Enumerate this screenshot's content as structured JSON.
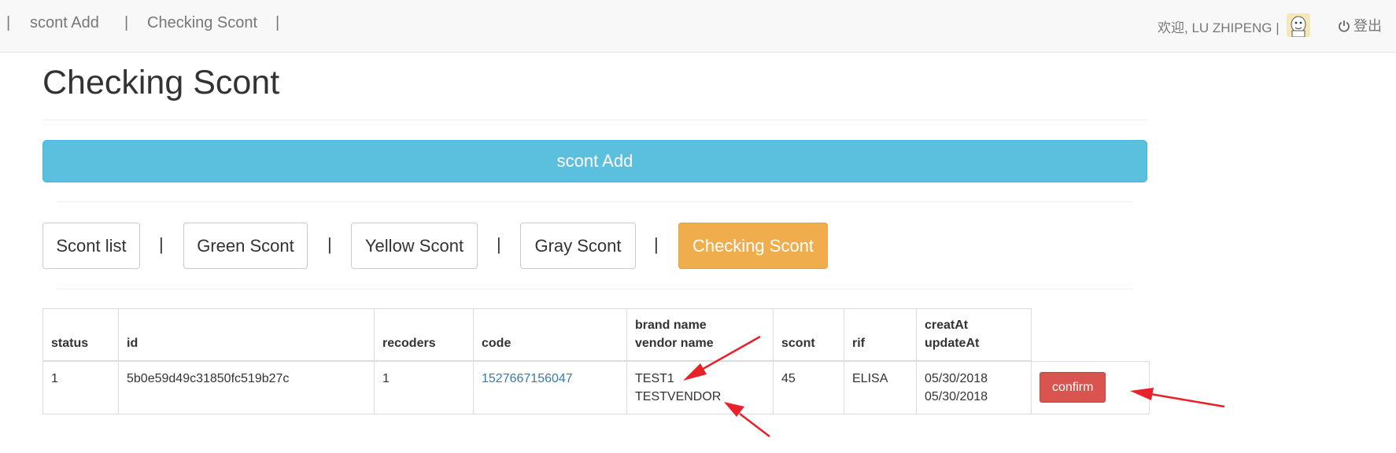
{
  "nav": {
    "sep": "|",
    "items": [
      "scont Add",
      "Checking Scont"
    ]
  },
  "user": {
    "welcome": "欢迎, LU ZHIPENG",
    "sep": "|",
    "logout": "登出"
  },
  "page": {
    "title": "Checking Scont",
    "add_button": "scont Add"
  },
  "filters": {
    "items": [
      "Scont list",
      "Green Scont",
      "Yellow Scont",
      "Gray Scont",
      "Checking Scont"
    ],
    "active": "Checking Scont",
    "sep": "|"
  },
  "table": {
    "headers": [
      "status",
      "id",
      "recoders",
      "code",
      "brand name",
      "vendor name",
      "scont",
      "rif",
      "creatAt",
      "updateAt"
    ],
    "rows": [
      {
        "status": "1",
        "id": "5b0e59d49c31850fc519b27c",
        "recoders": "1",
        "code": "1527667156047",
        "brand_name": "TEST1",
        "vendor_name": "TESTVENDOR",
        "scont": "45",
        "rif": "ELISA",
        "created_at": "05/30/2018",
        "updated_at": "05/30/2018",
        "action": "confirm"
      }
    ]
  },
  "colors": {
    "info": "#5bc0de",
    "warning": "#f0ad4e",
    "danger": "#d9534f",
    "link": "#337ab7",
    "annotation_arrow": "#e8212b"
  },
  "icons": [
    "power-icon",
    "avatar-icon",
    "annotation-arrow"
  ]
}
